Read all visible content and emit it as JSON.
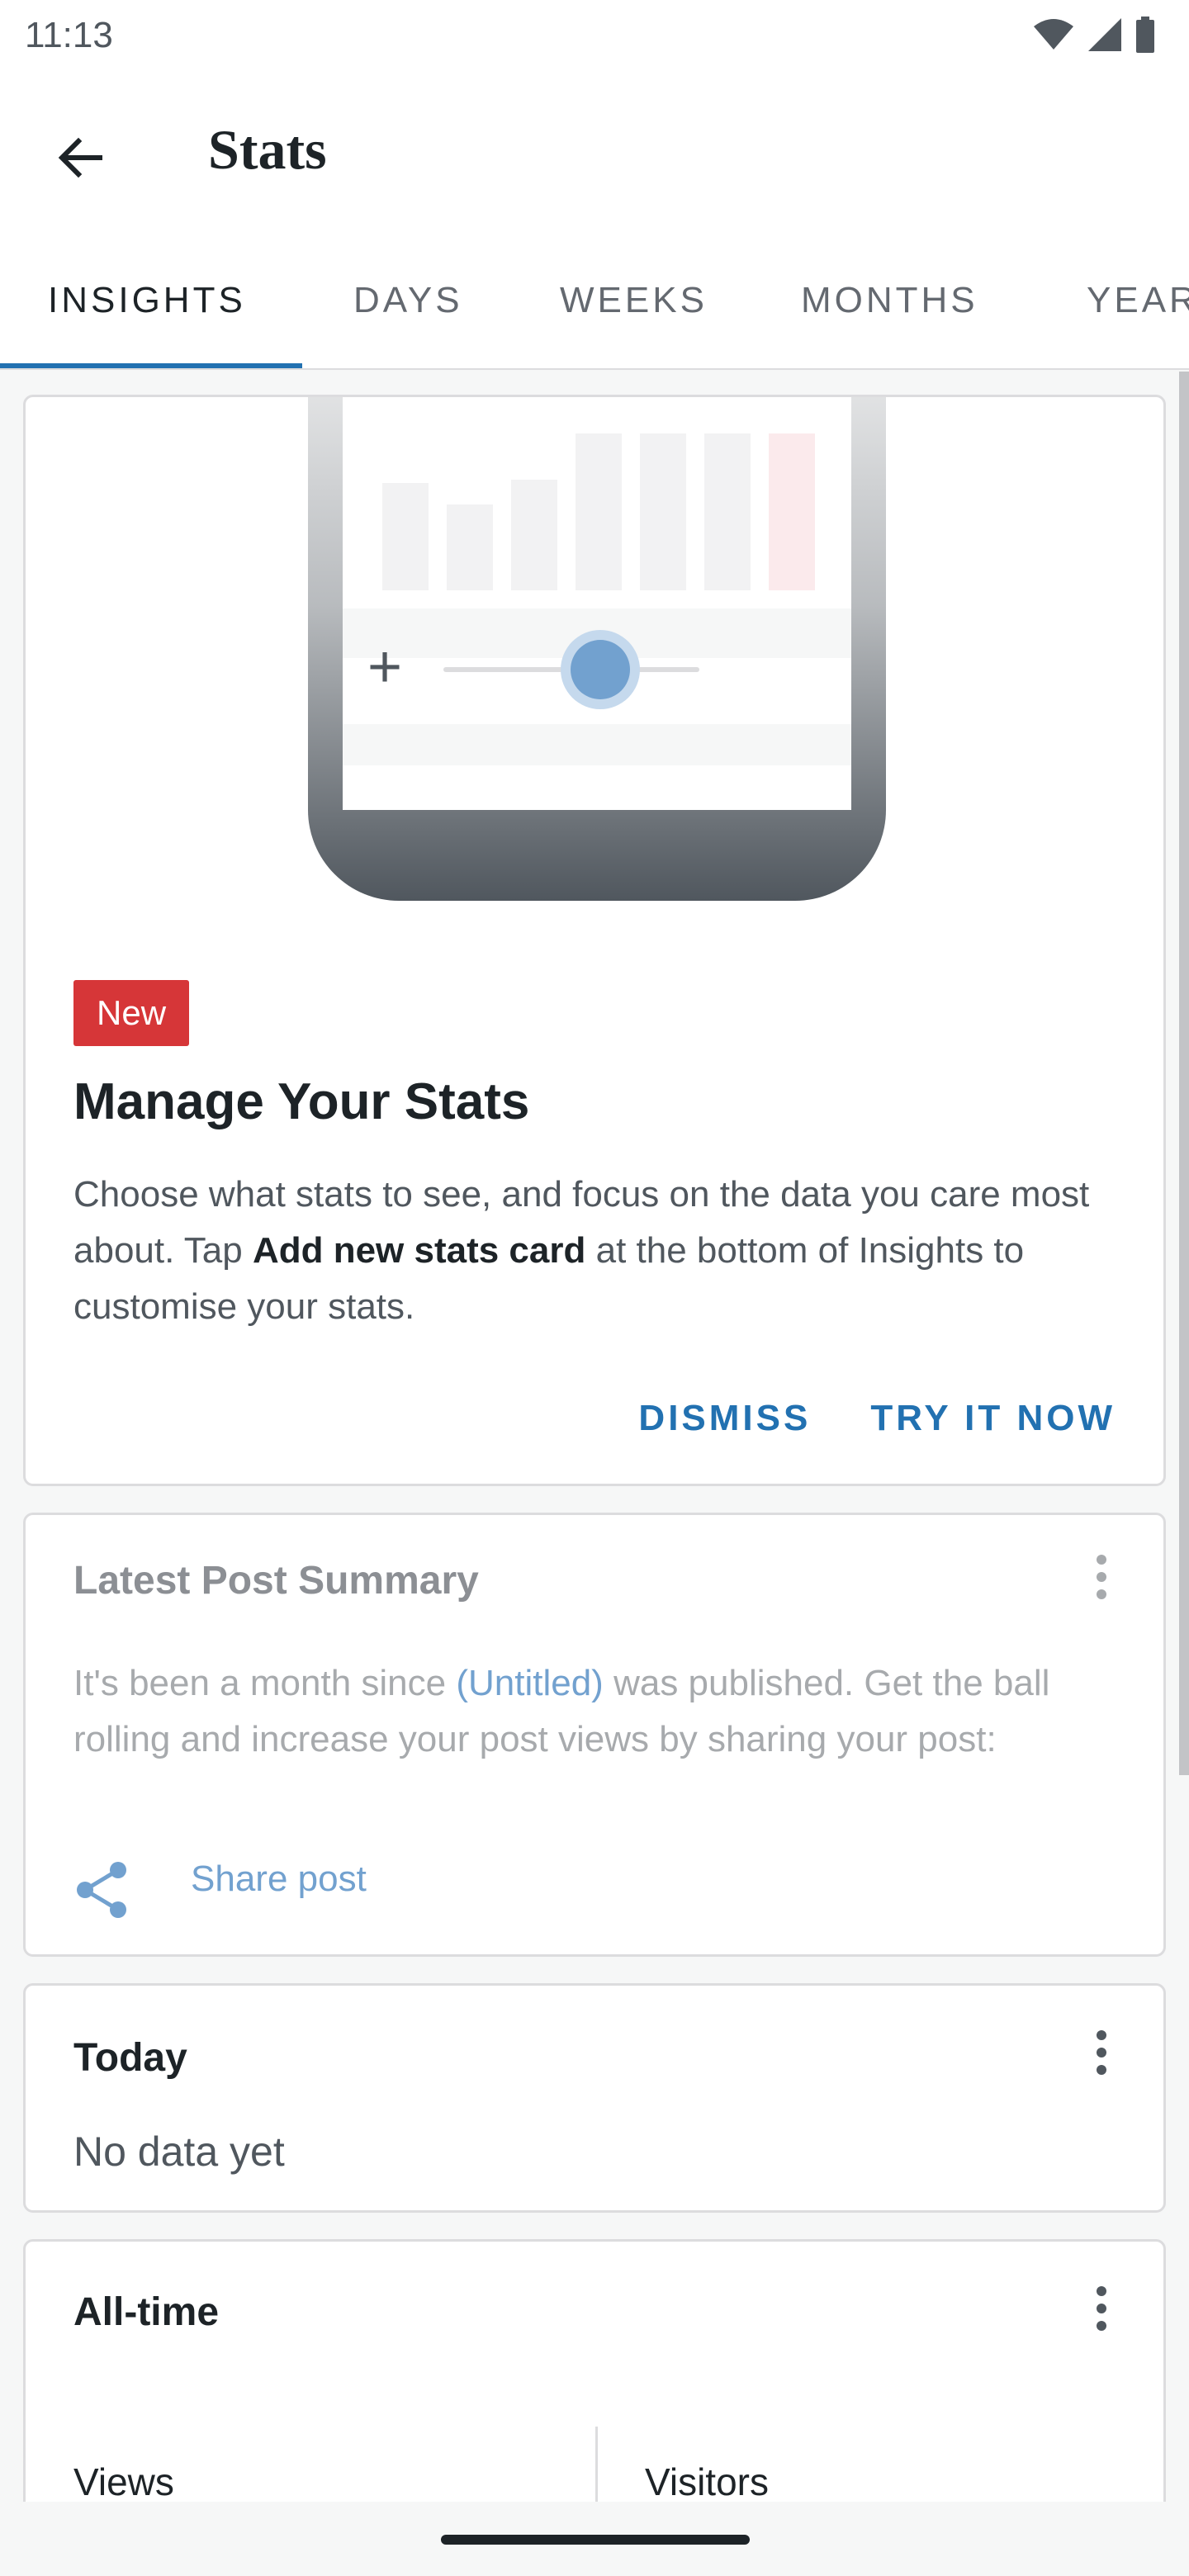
{
  "status_bar": {
    "time": "11:13",
    "icons": [
      "wifi-icon",
      "signal-icon",
      "battery-icon"
    ]
  },
  "app_bar": {
    "title": "Stats",
    "back_icon": "arrow-left-icon"
  },
  "tabs": [
    {
      "label": "INSIGHTS",
      "active": true
    },
    {
      "label": "DAYS",
      "active": false
    },
    {
      "label": "WEEKS",
      "active": false
    },
    {
      "label": "MONTHS",
      "active": false
    },
    {
      "label": "YEARS",
      "active": false
    }
  ],
  "promo_card": {
    "badge": "New",
    "title": "Manage Your Stats",
    "body_before": "Choose what stats to see, and focus on the data you care most about. Tap ",
    "body_bold": "Add new stats card",
    "body_after": " at the bottom of Insights to customise your stats.",
    "dismiss_label": "DISMISS",
    "try_label": "TRY IT NOW"
  },
  "latest_post_card": {
    "title": "Latest Post Summary",
    "body_before": "It's been a month since ",
    "post_link": "(Untitled)",
    "body_after": " was published. Get the ball rolling and increase your post views by sharing your post:",
    "share_label": "Share post",
    "share_icon": "share-icon",
    "more_icon": "more-vertical-icon"
  },
  "today_card": {
    "title": "Today",
    "empty_text": "No data yet",
    "more_icon": "more-vertical-icon"
  },
  "alltime_card": {
    "title": "All-time",
    "columns": [
      "Views",
      "Visitors"
    ],
    "more_icon": "more-vertical-icon"
  },
  "colors": {
    "accent": "#2271b1",
    "badge_red": "#d63638",
    "text_primary": "#1d2327",
    "text_secondary": "#50575e",
    "link_dim": "#72a1cf"
  }
}
